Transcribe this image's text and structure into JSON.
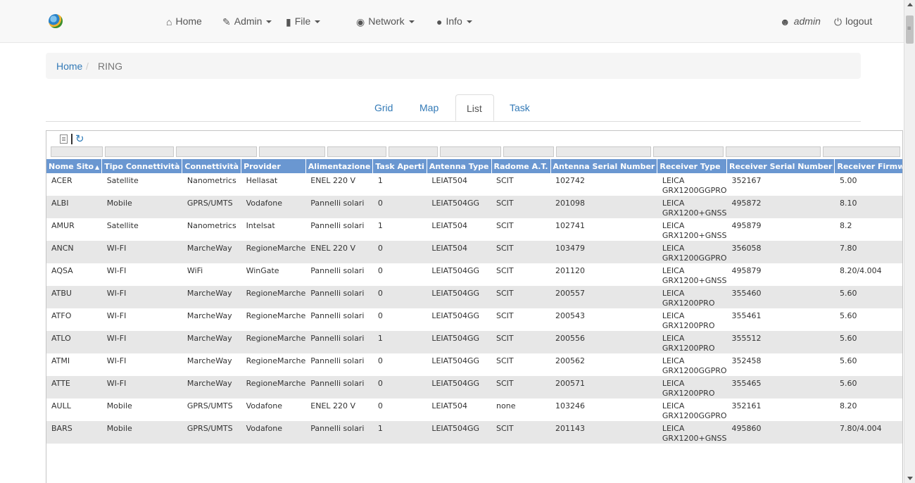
{
  "nav": {
    "home": "Home",
    "admin": "Admin",
    "file": "File",
    "network": "Network",
    "info": "Info",
    "user": "admin",
    "logout": "logout"
  },
  "breadcrumb": {
    "home": "Home",
    "separator": "/",
    "current": "RING"
  },
  "tabs": {
    "grid": "Grid",
    "map": "Map",
    "list": "List",
    "task": "Task"
  },
  "table": {
    "columns": [
      "Nome Sito",
      "Tipo Connettività",
      "Connettività",
      "Provider",
      "Alimentazione",
      "Task Aperti",
      "Antenna Type",
      "Radome A.T.",
      "Antenna Serial Number",
      "Receiver Type",
      "Receiver Serial Number",
      "Receiver Firmware"
    ],
    "rows": [
      {
        "site": "ACER",
        "conn_type": "Satellite",
        "conn": "Nanometrics",
        "provider": "Hellasat",
        "power": "ENEL 220 V",
        "tasks": "1",
        "antenna": "LEIAT504",
        "radome": "SCIT",
        "antenna_sn": "102742",
        "receiver": "LEICA GRX1200GGPRO",
        "receiver_sn": "352167",
        "firmware": "5.00"
      },
      {
        "site": "ALBI",
        "conn_type": "Mobile",
        "conn": "GPRS/UMTS",
        "provider": "Vodafone",
        "power": "Pannelli solari",
        "tasks": "0",
        "antenna": "LEIAT504GG",
        "radome": "SCIT",
        "antenna_sn": "201098",
        "receiver": "LEICA GRX1200+GNSS",
        "receiver_sn": "495872",
        "firmware": "8.10"
      },
      {
        "site": "AMUR",
        "conn_type": "Satellite",
        "conn": "Nanometrics",
        "provider": "Intelsat",
        "power": "Pannelli solari",
        "tasks": "1",
        "antenna": "LEIAT504",
        "radome": "SCIT",
        "antenna_sn": "102741",
        "receiver": "LEICA GRX1200+GNSS",
        "receiver_sn": "495879",
        "firmware": "8.2"
      },
      {
        "site": "ANCN",
        "conn_type": "WI-FI",
        "conn": "MarcheWay",
        "provider": "RegioneMarche",
        "power": "ENEL 220 V",
        "tasks": "0",
        "antenna": "LEIAT504",
        "radome": "SCIT",
        "antenna_sn": "103479",
        "receiver": "LEICA GRX1200GGPRO",
        "receiver_sn": "356058",
        "firmware": "7.80"
      },
      {
        "site": "AQSA",
        "conn_type": "WI-FI",
        "conn": "WiFi",
        "provider": "WinGate",
        "power": "Pannelli solari",
        "tasks": "0",
        "antenna": "LEIAT504GG",
        "radome": "SCIT",
        "antenna_sn": "201120",
        "receiver": "LEICA GRX1200+GNSS",
        "receiver_sn": "495879",
        "firmware": "8.20/4.004"
      },
      {
        "site": "ATBU",
        "conn_type": "WI-FI",
        "conn": "MarcheWay",
        "provider": "RegioneMarche",
        "power": "Pannelli solari",
        "tasks": "0",
        "antenna": "LEIAT504GG",
        "radome": "SCIT",
        "antenna_sn": "200557",
        "receiver": "LEICA GRX1200PRO",
        "receiver_sn": "355460",
        "firmware": "5.60"
      },
      {
        "site": "ATFO",
        "conn_type": "WI-FI",
        "conn": "MarcheWay",
        "provider": "RegioneMarche",
        "power": "Pannelli solari",
        "tasks": "0",
        "antenna": "LEIAT504GG",
        "radome": "SCIT",
        "antenna_sn": "200543",
        "receiver": "LEICA GRX1200PRO",
        "receiver_sn": "355461",
        "firmware": "5.60"
      },
      {
        "site": "ATLO",
        "conn_type": "WI-FI",
        "conn": "MarcheWay",
        "provider": "RegioneMarche",
        "power": "Pannelli solari",
        "tasks": "1",
        "antenna": "LEIAT504GG",
        "radome": "SCIT",
        "antenna_sn": "200556",
        "receiver": "LEICA GRX1200PRO",
        "receiver_sn": "355512",
        "firmware": "5.60"
      },
      {
        "site": "ATMI",
        "conn_type": "WI-FI",
        "conn": "MarcheWay",
        "provider": "RegioneMarche",
        "power": "Pannelli solari",
        "tasks": "0",
        "antenna": "LEIAT504GG",
        "radome": "SCIT",
        "antenna_sn": "200562",
        "receiver": "LEICA GRX1200GGPRO",
        "receiver_sn": "352458",
        "firmware": "5.60"
      },
      {
        "site": "ATTE",
        "conn_type": "WI-FI",
        "conn": "MarcheWay",
        "provider": "RegioneMarche",
        "power": "Pannelli solari",
        "tasks": "0",
        "antenna": "LEIAT504GG",
        "radome": "SCIT",
        "antenna_sn": "200571",
        "receiver": "LEICA GRX1200PRO",
        "receiver_sn": "355465",
        "firmware": "5.60"
      },
      {
        "site": "AULL",
        "conn_type": "Mobile",
        "conn": "GPRS/UMTS",
        "provider": "Vodafone",
        "power": "ENEL 220 V",
        "tasks": "0",
        "antenna": "LEIAT504",
        "radome": "none",
        "antenna_sn": "103246",
        "receiver": "LEICA GRX1200GGPRO",
        "receiver_sn": "352161",
        "firmware": "8.20"
      },
      {
        "site": "BARS",
        "conn_type": "Mobile",
        "conn": "GPRS/UMTS",
        "provider": "Vodafone",
        "power": "Pannelli solari",
        "tasks": "1",
        "antenna": "LEIAT504GG",
        "radome": "SCIT",
        "antenna_sn": "201143",
        "receiver": "LEICA GRX1200+GNSS",
        "receiver_sn": "495860",
        "firmware": "7.80/4.004"
      }
    ]
  }
}
